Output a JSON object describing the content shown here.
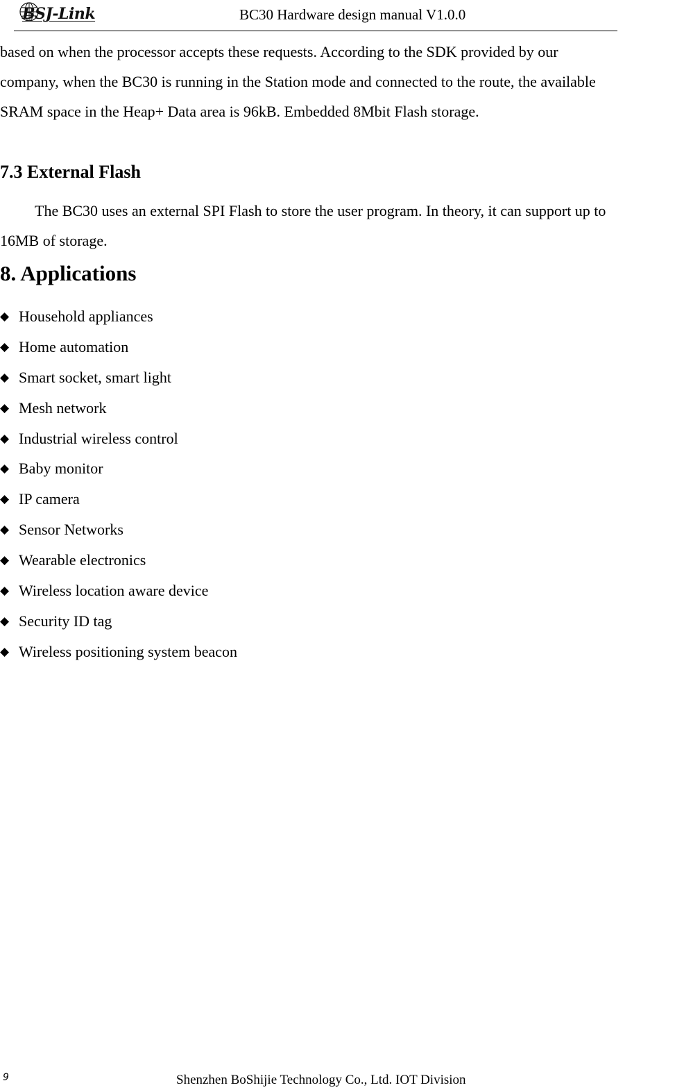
{
  "header": {
    "logo_text": "BSJ-Link",
    "logo_icon": "globe-icon",
    "title": "BC30 Hardware design manual V1.0.0"
  },
  "body": {
    "intro_lines": [
      "based on when the processor accepts these requests. According to the SDK provided by our",
      "company, when the BC30 is running in the Station mode and connected to the route, the available",
      "SRAM space in the Heap+ Data area is 96kB. Embedded 8Mbit Flash storage."
    ],
    "section_7_3": {
      "heading": "7.3 External Flash",
      "lines": [
        "The BC30 uses an external SPI Flash to store the user program. In theory, it can support up to",
        "16MB of storage."
      ]
    },
    "section_8": {
      "heading": "8. Applications",
      "bullet_glyph": "◆",
      "items": [
        "Household appliances",
        "Home automation",
        "Smart socket, smart light",
        "Mesh network",
        "Industrial wireless control",
        "Baby monitor",
        "IP camera",
        "Sensor Networks",
        "Wearable electronics",
        "Wireless location aware device",
        "Security ID tag",
        "Wireless positioning system beacon"
      ]
    }
  },
  "footer": {
    "page_number": "9",
    "company": "Shenzhen BoShijie Technology Co., Ltd. IOT Division"
  }
}
